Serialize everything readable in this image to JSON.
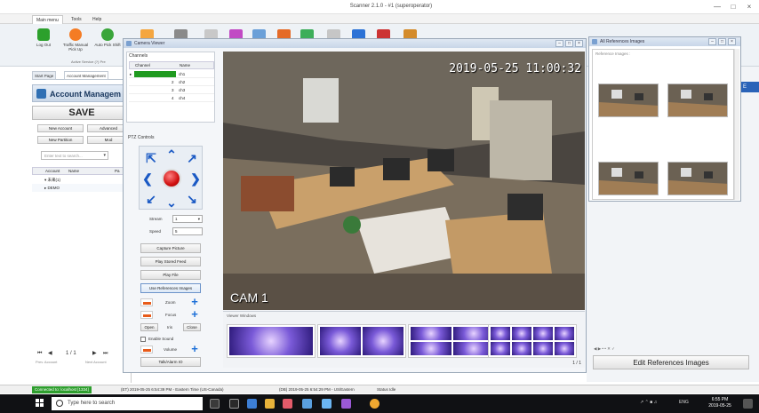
{
  "window": {
    "title": "Scanner 2.1.0 - #1 (superoperator)"
  },
  "menu_tabs": [
    "Main menu",
    "Tools",
    "Help"
  ],
  "ribbon": {
    "buttons": [
      {
        "label": "Log Out"
      },
      {
        "label": "Traffic Manual Pick Up"
      },
      {
        "label": "Auto Pick Shift"
      }
    ],
    "caption": "Active Service (?) Pre"
  },
  "left_panel": {
    "tabs": [
      "Start Page",
      "Account Management"
    ],
    "title": "Account Managem",
    "save": "SAVE",
    "buttons": [
      "New Account",
      "Advanced",
      "New Partition",
      "Mod"
    ],
    "search_placeholder": "Enter text to search...",
    "grid_headers": [
      "Account",
      "Name",
      "Pa"
    ],
    "rows": [
      {
        "account": "▾ 未来(1)",
        "name": ""
      },
      {
        "account": "▸ DEMO",
        "name": ""
      }
    ],
    "pager": "1 / 1",
    "footer": [
      "Prev. Account",
      "Next Account"
    ]
  },
  "camera_window": {
    "title": "Camera Viewer",
    "channels_caption": "Channels",
    "channel_headers": [
      "Channel",
      "Name"
    ],
    "channels": [
      {
        "num": "",
        "name": "ch1"
      },
      {
        "num": "2",
        "name": "ch2"
      },
      {
        "num": "3",
        "name": "ch3"
      },
      {
        "num": "4",
        "name": "ch4"
      }
    ],
    "ptz_caption": "PTZ Controls",
    "stream_label": "Stream",
    "stream_value": "1",
    "speed_label": "Speed",
    "speed_value": "5",
    "buttons": [
      "Capture Picture",
      "Play Stored Feed",
      "Play File",
      "Use References Images"
    ],
    "zoom_label": "Zoom",
    "focus_label": "Focus",
    "iris_buttons": [
      "Open",
      "Iris",
      "Close"
    ],
    "enable_sound": "Enable Sound",
    "volume_label": "Volume",
    "talk_button": "Talk/Alarm IO",
    "timestamp": "2019-05-25 11:00:32",
    "cam_label": "CAM 1",
    "viewer_caption": "Viewer Windows",
    "page_indicator": "1 / 1"
  },
  "references_window": {
    "title": "All References Images",
    "caption": "Reference Images :",
    "images_count": 4
  },
  "edit_references": "Edit References Images",
  "status_bar": {
    "connection": "Connected to: localhost [1334]",
    "items": [
      "(ET) 2019-05-25 6:54:39 PM - Eastern Time (US-Canada)",
      "(DB) 2019-05-25 6:54:29 PM - US/Eastern",
      "Status Idle"
    ]
  },
  "taskbar": {
    "search_placeholder": "Type here to search",
    "tray": "ENG",
    "time": "6:55 PM",
    "date": "2019-05-25"
  },
  "colors": {
    "accent_blue": "#1a59c4",
    "connected_green": "#2e9e2e",
    "channel_active": "#1f9a1f",
    "stop_red": "#d01010"
  }
}
